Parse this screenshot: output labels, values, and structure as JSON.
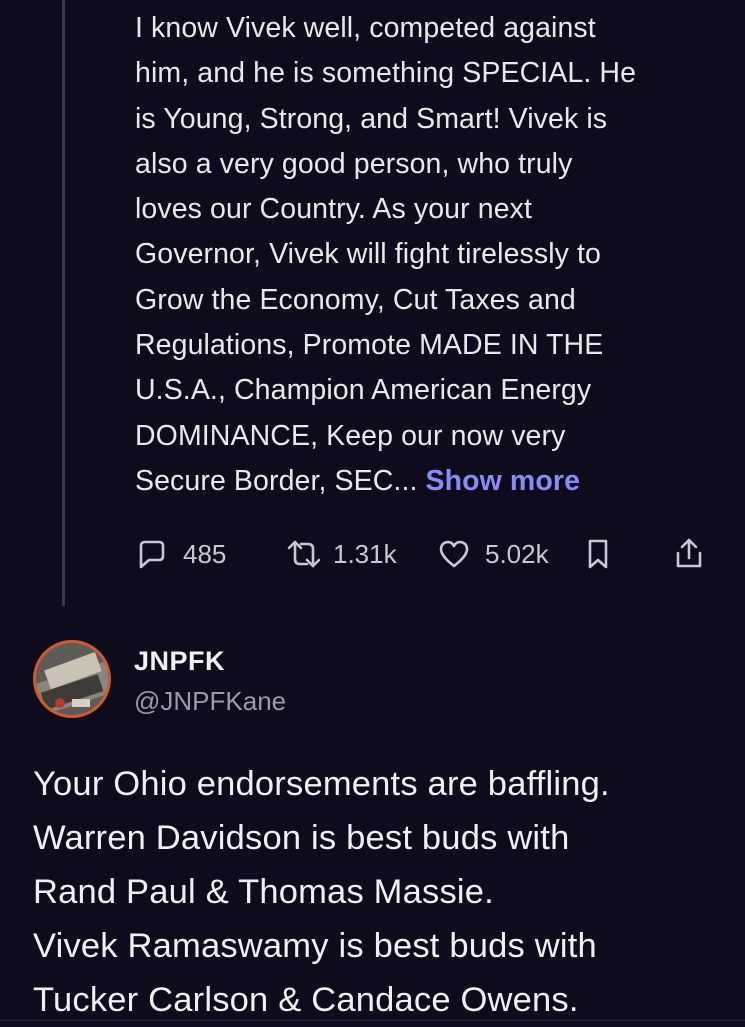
{
  "post": {
    "text_lines": [
      "I know Vivek well, competed against",
      "him, and he is something SPECIAL. He",
      "is Young, Strong, and Smart! Vivek is",
      "also a very good person, who truly",
      "loves our Country. As your next",
      "Governor, Vivek will fight tirelessly to",
      "Grow the Economy, Cut Taxes and",
      "Regulations, Promote MADE IN THE",
      "U.S.A., Champion American Energy",
      "DOMINANCE, Keep our now very"
    ],
    "last_line": "Secure Border, SEC...",
    "show_more_label": "Show more",
    "replies_count": "485",
    "reposts_count": "1.31k",
    "likes_count": "5.02k"
  },
  "reply": {
    "display_name": "JNPFK",
    "handle": "@JNPFKane",
    "text_lines": [
      "Your Ohio endorsements are baffling.",
      "Warren Davidson is best buds with",
      "Rand Paul & Thomas Massie.",
      "Vivek Ramaswamy is best buds with",
      "Tucker Carlson & Candace Owens."
    ]
  },
  "icons": {
    "reply": "comment-bubble-icon",
    "repost": "repost-arrows-icon",
    "like": "heart-icon",
    "bookmark": "bookmark-icon",
    "share": "share-icon"
  },
  "colors": {
    "background": "#0e0b1c",
    "text": "#e7e9ea",
    "muted": "#9a9aa8",
    "link": "#8b8bf5",
    "thread_line": "#3a3550"
  }
}
